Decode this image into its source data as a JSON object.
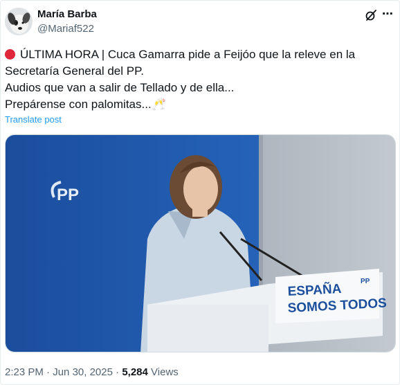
{
  "tweet": {
    "author_name": "María Barba",
    "author_handle": "@Mariaf522",
    "text_lines": [
      "ÚLTIMA HORA | Cuca Gamarra pide a Feijóo que la releve en la",
      "Secretaría General del PP.",
      "Audios que van a salir de Tellado y de ella...",
      "Prepárense con palomitas...🥂"
    ],
    "translate_label": "Translate post",
    "time": "2:23 PM",
    "separator": "·",
    "date": "Jun 30, 2025",
    "views_count": "5,284",
    "views_label": "Views"
  },
  "media": {
    "wall_logo": "PP",
    "podium_line1": "ESPAÑA",
    "podium_line2": "SOMOS TODOS",
    "podium_logo": "PP"
  },
  "icons": [
    "avatar-dog-photo",
    "grok-icon",
    "more-icon",
    "breaking-red-dot-icon"
  ],
  "colors": {
    "link": "#1d9bf0",
    "muted": "#536471",
    "text": "#0f1419",
    "backdrop_blue": "#1f56a8"
  }
}
